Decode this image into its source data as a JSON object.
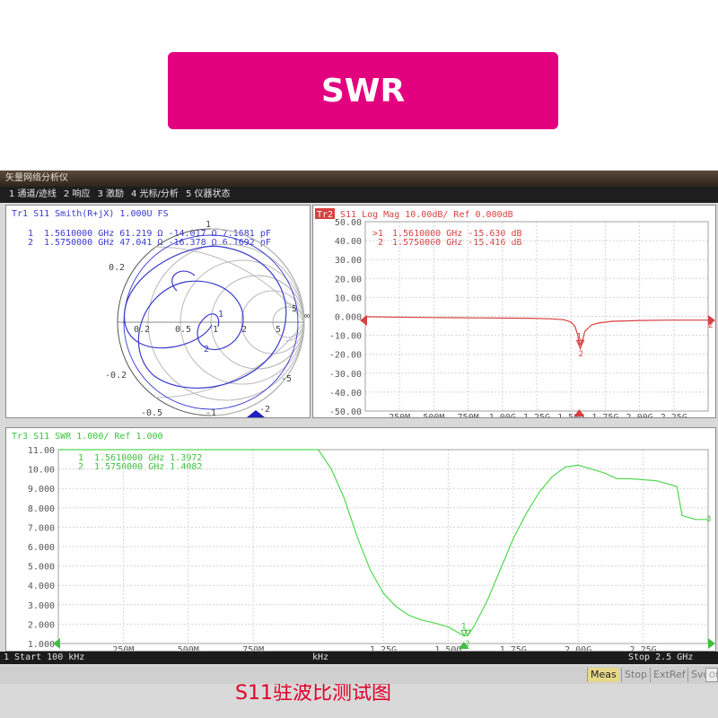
{
  "banner": {
    "title": "SWR"
  },
  "window": {
    "title": "矢量网络分析仪",
    "menu": [
      "1 通道/迹线",
      "2 响应",
      "3 激励",
      "4 光标/分析",
      "5 仪器状态"
    ]
  },
  "overlay_caption": "S11驻波比测试图",
  "colors": {
    "banner": "#e2007f",
    "smith": "#3a3ad0",
    "logmag": "#d84040",
    "swr": "#40d040"
  },
  "smith": {
    "header": "Tr1 S11 Smith(R+jX) 1.000U FS",
    "markers": [
      {
        "label": "1",
        "text": "1.5610000 GHz  61.219 Ω -14.017 Ω  7.1681 pF"
      },
      {
        "label": "2",
        "text": "1.5750000 GHz  47.041 Ω -16.378 Ω  6.1692 pF"
      }
    ],
    "ticks": {
      "top": "1",
      "left": "0.2",
      "left_low": "-0.2",
      "right": "5",
      "right_low": "-5",
      "bottom": "-1",
      "bottom_left": "-0.5",
      "bottom_right": "-2",
      "center_row": [
        "0.2",
        "0.5",
        "1",
        "2",
        "5"
      ],
      "infinity": "∞"
    }
  },
  "logmag": {
    "tr_badge": "Tr2",
    "header": "S11 Log Mag 10.00dB/ Ref 0.000dB",
    "markers": [
      {
        "label": ">1",
        "text": "1.5610000 GHz -15.630 dB"
      },
      {
        "label": "2",
        "text": "1.5750000 GHz -15.416 dB"
      }
    ],
    "right_label": "2"
  },
  "swr": {
    "header": "Tr3 S11 SWR 1.000/ Ref 1.000",
    "markers": [
      {
        "label": "1",
        "text": "1.5610000 GHz  1.3972"
      },
      {
        "label": "2",
        "text": "1.5750000 GHz  1.4082"
      }
    ],
    "right_label": "3"
  },
  "status": {
    "start": "1  Start 100 kHz",
    "unit": "kHz",
    "stop": "Stop 2.5 GHz"
  },
  "bottom_buttons": {
    "meas": "Meas",
    "stop": "Stop",
    "extref": "ExtRef",
    "svc": "Svc",
    "off": "Off"
  },
  "chart_data": [
    {
      "type": "line",
      "title": "S11 Log Mag 10.00dB/ Ref 0.000dB",
      "x_tick_labels": [
        "250M",
        "500M",
        "750M",
        "1.00G",
        "1.25G",
        "1.50G",
        "1.75G",
        "2.00G",
        "2.25G"
      ],
      "x_ticks": [
        0.25,
        0.5,
        0.75,
        1.0,
        1.25,
        1.5,
        1.75,
        2.0,
        2.25
      ],
      "y_tick_labels": [
        "50.00",
        "40.00",
        "30.00",
        "20.00",
        "10.00",
        "0.000",
        "-10.00",
        "-20.00",
        "-30.00",
        "-40.00",
        "-50.00"
      ],
      "xlim": [
        0.0001,
        2.5
      ],
      "ylim": [
        -50,
        50
      ],
      "grid": true,
      "series": [
        {
          "x": [
            0.0001,
            0.2,
            0.5,
            0.8,
            1.0,
            1.2,
            1.35,
            1.45,
            1.5,
            1.53,
            1.55,
            1.561,
            1.568,
            1.575,
            1.6,
            1.65,
            1.7,
            1.8,
            2.0,
            2.2,
            2.5
          ],
          "y": [
            -0.2,
            -0.4,
            -0.6,
            -0.8,
            -0.9,
            -1.0,
            -1.3,
            -1.8,
            -3.0,
            -5.5,
            -10.0,
            -15.63,
            -17.0,
            -15.42,
            -8.0,
            -4.5,
            -3.5,
            -2.6,
            -2.2,
            -2.0,
            -2.0
          ]
        }
      ],
      "markers": [
        {
          "label": "1",
          "x": 1.561,
          "y": -15.63
        },
        {
          "label": "2",
          "x": 1.575,
          "y": -15.416
        }
      ]
    },
    {
      "type": "line",
      "title": "S11 SWR 1.000/ Ref 1.000",
      "x_tick_labels": [
        "250M",
        "500M",
        "750M",
        "1.25G",
        "1.50G",
        "1.75G",
        "2.00G",
        "2.25G"
      ],
      "x_ticks": [
        0.25,
        0.5,
        0.75,
        1.25,
        1.5,
        1.75,
        2.0,
        2.25
      ],
      "y_tick_labels": [
        "11.00",
        "10.00",
        "9.000",
        "8.000",
        "7.000",
        "6.000",
        "5.000",
        "4.000",
        "3.000",
        "2.000",
        "1.000"
      ],
      "xlim": [
        0.0001,
        2.5
      ],
      "ylim": [
        1,
        11
      ],
      "grid": true,
      "series": [
        {
          "x": [
            1.0,
            1.05,
            1.1,
            1.15,
            1.2,
            1.25,
            1.3,
            1.35,
            1.4,
            1.45,
            1.5,
            1.54,
            1.561,
            1.575,
            1.6,
            1.65,
            1.7,
            1.75,
            1.8,
            1.85,
            1.9,
            1.95,
            2.0,
            2.05,
            2.1,
            2.15,
            2.2,
            2.3,
            2.38,
            2.4,
            2.45,
            2.5
          ],
          "y": [
            11.0,
            10.0,
            8.5,
            6.5,
            4.8,
            3.6,
            2.9,
            2.45,
            2.2,
            2.05,
            1.85,
            1.55,
            1.3972,
            1.4082,
            1.9,
            3.2,
            4.8,
            6.4,
            7.7,
            8.8,
            9.6,
            10.1,
            10.2,
            10.0,
            9.8,
            9.5,
            9.5,
            9.4,
            9.1,
            7.6,
            7.4,
            7.4
          ]
        }
      ],
      "markers": [
        {
          "label": "1",
          "x": 1.561,
          "y": 1.3972
        },
        {
          "label": "2",
          "x": 1.575,
          "y": 1.4082
        }
      ]
    }
  ]
}
